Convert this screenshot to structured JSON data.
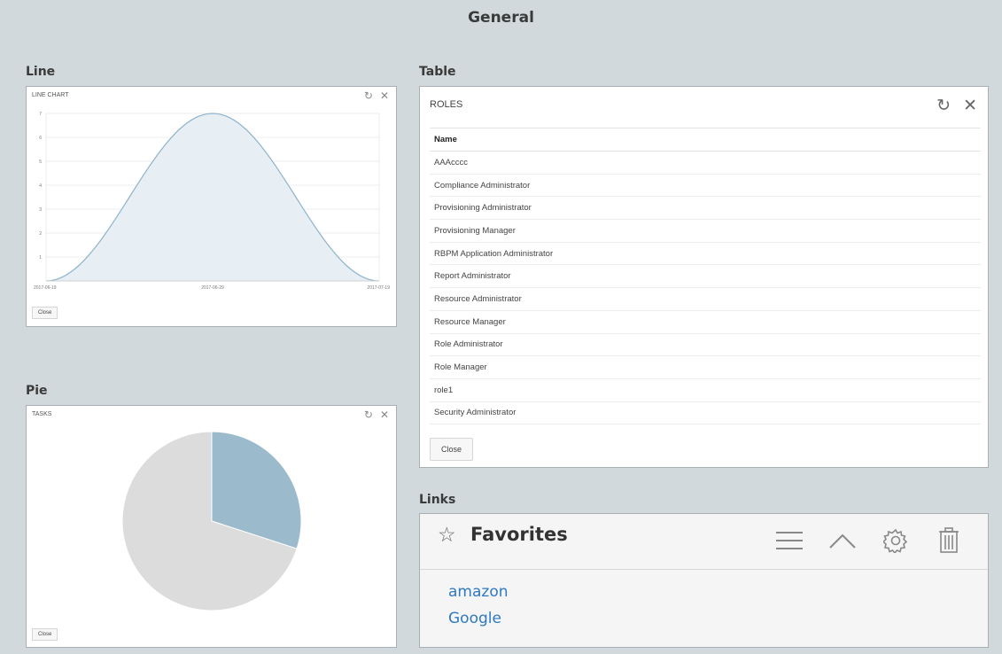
{
  "page": {
    "title": "General"
  },
  "sections": {
    "line": "Line",
    "table": "Table",
    "pie": "Pie",
    "links": "Links"
  },
  "line_panel": {
    "heading": "LINE CHART",
    "close_label": "Close"
  },
  "pie_panel": {
    "heading": "TASKS",
    "close_label": "Close"
  },
  "table_panel": {
    "heading": "ROLES",
    "column": "Name",
    "rows": [
      "AAAcccc",
      "Compliance Administrator",
      "Provisioning Administrator",
      "Provisioning Manager",
      "RBPM Application Administrator",
      "Report Administrator",
      "Resource Administrator",
      "Resource Manager",
      "Role Administrator",
      "Role Manager",
      "role1",
      "Security Administrator"
    ],
    "close_label": "Close"
  },
  "favorites": {
    "title": "Favorites",
    "links": [
      "amazon",
      "Google"
    ]
  },
  "icons": {
    "refresh": "refresh-icon",
    "close": "close-icon",
    "star": "star-icon",
    "menu": "menu-icon",
    "collapse": "chevron-up-icon",
    "settings": "gear-icon",
    "delete": "trash-icon"
  },
  "colors": {
    "background": "#d1d9dc",
    "line_stroke": "#8fb3cc",
    "line_fill": "#e7eff4",
    "pie_highlight": "#9bbacc",
    "pie_rest": "#dcdcdc",
    "link": "#2e79c2"
  },
  "chart_data": [
    {
      "type": "area",
      "x": [
        "2017-06-19",
        "2017-06-29",
        "2017-07-19"
      ],
      "y": [
        0,
        7,
        0
      ],
      "x_ticks": [
        "2017-06-19",
        "2017-06-29",
        "2017-07-19"
      ],
      "y_ticks": [
        1,
        2,
        3,
        4,
        5,
        6,
        7
      ],
      "ylim": [
        1,
        7
      ],
      "grid": true
    },
    {
      "type": "pie",
      "values": [
        30,
        70
      ],
      "colors": [
        "#9bbacc",
        "#dcdcdc"
      ]
    }
  ]
}
